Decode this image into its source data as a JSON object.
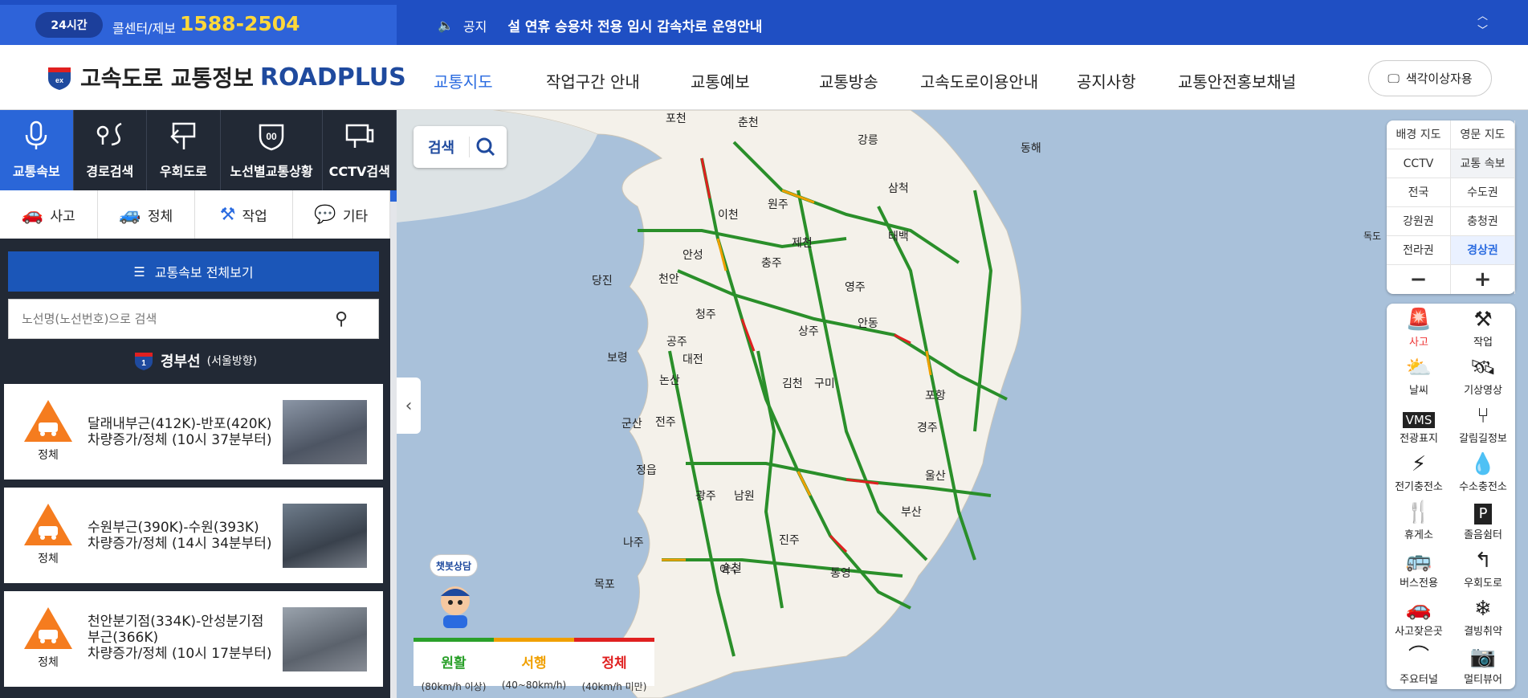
{
  "topbar": {
    "badge": "24시간",
    "call_label": "콜센터/제보",
    "call_number": "1588-2504",
    "notice_label": "공지",
    "notice_text": "설 연휴 승용차 전용 임시 감속차로 운영안내"
  },
  "header": {
    "logo_text": "고속도로 교통정보",
    "logo_brand": "ROADPLUS",
    "nav": [
      "교통지도",
      "작업구간 안내",
      "교통예보",
      "교통방송",
      "고속도로이용안내",
      "공지사항",
      "교통안전홍보채널"
    ],
    "color_button": "색각이상자용"
  },
  "left_panel": {
    "tabs": [
      "교통속보",
      "경로검색",
      "우회도로",
      "노선별교통상황",
      "CCTV검색"
    ],
    "filters": [
      "사고",
      "정체",
      "작업",
      "기타"
    ],
    "all_button": "교통속보 전체보기",
    "search_placeholder": "노선명(노선번호)으로 검색",
    "route_number": "1",
    "route_name": "경부선",
    "route_direction": "(서울방향)",
    "cards": [
      {
        "status": "정체",
        "line1": "달래내부근(412K)-반포(420K)",
        "line2": "차량증가/정체 (10시 37분부터)"
      },
      {
        "status": "정체",
        "line1": "수원부근(390K)-수원(393K)",
        "line2": "차량증가/정체 (14시 34분부터)"
      },
      {
        "status": "정체",
        "line1": "천안분기점(334K)-안성분기점 부근(366K)",
        "line2": "차량증가/정체 (10시 17분부터)"
      }
    ]
  },
  "map": {
    "search_label": "검색",
    "cities": [
      "포천",
      "춘천",
      "강릉",
      "동해",
      "삼척",
      "태백",
      "제천",
      "충주",
      "원주",
      "이천",
      "안성",
      "천안",
      "당진",
      "청주",
      "영주",
      "안동",
      "상주",
      "보령",
      "공주",
      "대전",
      "논산",
      "김천",
      "구미",
      "포항",
      "군산",
      "전주",
      "경주",
      "정읍",
      "광주",
      "남원",
      "나주",
      "진주",
      "순천",
      "목포",
      "여수",
      "통영",
      "부산",
      "울산",
      "독도"
    ],
    "chatbot_label": "챗봇상담",
    "legend": [
      {
        "status": "원활",
        "range": "(80km/h 이상)",
        "color": "#2aa02a"
      },
      {
        "status": "서행",
        "range": "(40~80km/h)",
        "color": "#f0a000"
      },
      {
        "status": "정체",
        "range": "(40km/h 미만)",
        "color": "#e02020"
      }
    ]
  },
  "right_controls": {
    "rows": [
      [
        "배경 지도",
        "영문 지도"
      ],
      [
        "CCTV",
        "교통 속보"
      ],
      [
        "전국",
        "수도권"
      ],
      [
        "강원권",
        "충청권"
      ],
      [
        "전라권",
        "경상권"
      ],
      [
        "−",
        "+"
      ]
    ],
    "selected": "경상권",
    "tools": [
      "사고",
      "작업",
      "날씨",
      "기상영상",
      "전광표지",
      "갈림길정보",
      "전기충전소",
      "수소충전소",
      "휴게소",
      "졸음쉼터",
      "버스전용",
      "우회도로",
      "사고잦은곳",
      "결빙취약",
      "주요터널",
      "멀티뷰어"
    ]
  }
}
